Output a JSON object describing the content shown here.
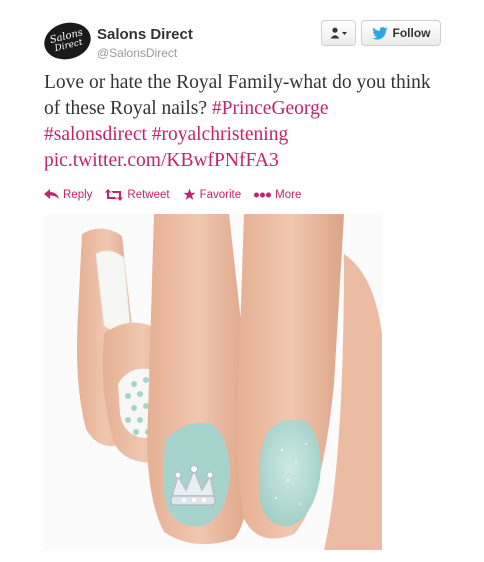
{
  "account": {
    "avatar_line1": "Salons",
    "avatar_line2": "Direct",
    "name": "Salons Direct",
    "handle": "@SalonsDirect"
  },
  "header": {
    "follow_label": "Follow",
    "user_menu_icon": "user-dropdown-icon",
    "follow_icon": "twitter-bird-icon"
  },
  "tweet": {
    "text": "Love or hate the Royal Family-what do you think of these Royal nails? ",
    "hashtags": [
      "#PrinceGeorge",
      "#salonsdirect",
      "#royalchristening"
    ],
    "link": "pic.twitter.com/KBwfPNfFA3"
  },
  "actions": [
    {
      "label": "Reply",
      "icon": "reply-icon"
    },
    {
      "label": "Retweet",
      "icon": "retweet-icon"
    },
    {
      "label": "Favorite",
      "icon": "star-icon"
    },
    {
      "label": "More",
      "icon": "more-dots-icon"
    }
  ],
  "colors": {
    "accent": "#c4226f",
    "text": "#333333",
    "muted": "#999999",
    "twitter_blue": "#2fa8e2",
    "nail_mint": "#a7d3cd",
    "nail_white": "#f7f7f5",
    "skin": "#e7b79d"
  }
}
